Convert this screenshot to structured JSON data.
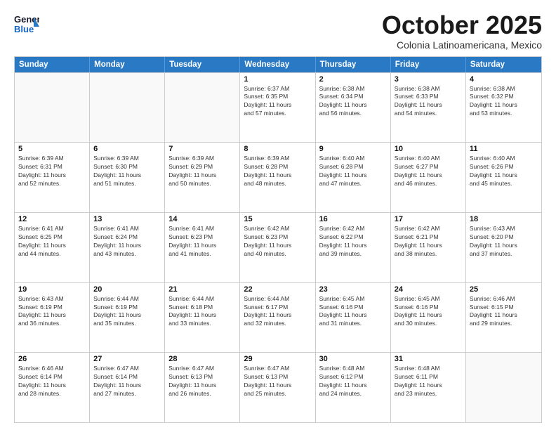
{
  "header": {
    "logo_general": "General",
    "logo_blue": "Blue",
    "title": "October 2025",
    "subtitle": "Colonia Latinoamericana, Mexico"
  },
  "weekdays": [
    "Sunday",
    "Monday",
    "Tuesday",
    "Wednesday",
    "Thursday",
    "Friday",
    "Saturday"
  ],
  "rows": [
    [
      {
        "day": "",
        "info": ""
      },
      {
        "day": "",
        "info": ""
      },
      {
        "day": "",
        "info": ""
      },
      {
        "day": "1",
        "info": "Sunrise: 6:37 AM\nSunset: 6:35 PM\nDaylight: 11 hours\nand 57 minutes."
      },
      {
        "day": "2",
        "info": "Sunrise: 6:38 AM\nSunset: 6:34 PM\nDaylight: 11 hours\nand 56 minutes."
      },
      {
        "day": "3",
        "info": "Sunrise: 6:38 AM\nSunset: 6:33 PM\nDaylight: 11 hours\nand 54 minutes."
      },
      {
        "day": "4",
        "info": "Sunrise: 6:38 AM\nSunset: 6:32 PM\nDaylight: 11 hours\nand 53 minutes."
      }
    ],
    [
      {
        "day": "5",
        "info": "Sunrise: 6:39 AM\nSunset: 6:31 PM\nDaylight: 11 hours\nand 52 minutes."
      },
      {
        "day": "6",
        "info": "Sunrise: 6:39 AM\nSunset: 6:30 PM\nDaylight: 11 hours\nand 51 minutes."
      },
      {
        "day": "7",
        "info": "Sunrise: 6:39 AM\nSunset: 6:29 PM\nDaylight: 11 hours\nand 50 minutes."
      },
      {
        "day": "8",
        "info": "Sunrise: 6:39 AM\nSunset: 6:28 PM\nDaylight: 11 hours\nand 48 minutes."
      },
      {
        "day": "9",
        "info": "Sunrise: 6:40 AM\nSunset: 6:28 PM\nDaylight: 11 hours\nand 47 minutes."
      },
      {
        "day": "10",
        "info": "Sunrise: 6:40 AM\nSunset: 6:27 PM\nDaylight: 11 hours\nand 46 minutes."
      },
      {
        "day": "11",
        "info": "Sunrise: 6:40 AM\nSunset: 6:26 PM\nDaylight: 11 hours\nand 45 minutes."
      }
    ],
    [
      {
        "day": "12",
        "info": "Sunrise: 6:41 AM\nSunset: 6:25 PM\nDaylight: 11 hours\nand 44 minutes."
      },
      {
        "day": "13",
        "info": "Sunrise: 6:41 AM\nSunset: 6:24 PM\nDaylight: 11 hours\nand 43 minutes."
      },
      {
        "day": "14",
        "info": "Sunrise: 6:41 AM\nSunset: 6:23 PM\nDaylight: 11 hours\nand 41 minutes."
      },
      {
        "day": "15",
        "info": "Sunrise: 6:42 AM\nSunset: 6:23 PM\nDaylight: 11 hours\nand 40 minutes."
      },
      {
        "day": "16",
        "info": "Sunrise: 6:42 AM\nSunset: 6:22 PM\nDaylight: 11 hours\nand 39 minutes."
      },
      {
        "day": "17",
        "info": "Sunrise: 6:42 AM\nSunset: 6:21 PM\nDaylight: 11 hours\nand 38 minutes."
      },
      {
        "day": "18",
        "info": "Sunrise: 6:43 AM\nSunset: 6:20 PM\nDaylight: 11 hours\nand 37 minutes."
      }
    ],
    [
      {
        "day": "19",
        "info": "Sunrise: 6:43 AM\nSunset: 6:19 PM\nDaylight: 11 hours\nand 36 minutes."
      },
      {
        "day": "20",
        "info": "Sunrise: 6:44 AM\nSunset: 6:19 PM\nDaylight: 11 hours\nand 35 minutes."
      },
      {
        "day": "21",
        "info": "Sunrise: 6:44 AM\nSunset: 6:18 PM\nDaylight: 11 hours\nand 33 minutes."
      },
      {
        "day": "22",
        "info": "Sunrise: 6:44 AM\nSunset: 6:17 PM\nDaylight: 11 hours\nand 32 minutes."
      },
      {
        "day": "23",
        "info": "Sunrise: 6:45 AM\nSunset: 6:16 PM\nDaylight: 11 hours\nand 31 minutes."
      },
      {
        "day": "24",
        "info": "Sunrise: 6:45 AM\nSunset: 6:16 PM\nDaylight: 11 hours\nand 30 minutes."
      },
      {
        "day": "25",
        "info": "Sunrise: 6:46 AM\nSunset: 6:15 PM\nDaylight: 11 hours\nand 29 minutes."
      }
    ],
    [
      {
        "day": "26",
        "info": "Sunrise: 6:46 AM\nSunset: 6:14 PM\nDaylight: 11 hours\nand 28 minutes."
      },
      {
        "day": "27",
        "info": "Sunrise: 6:47 AM\nSunset: 6:14 PM\nDaylight: 11 hours\nand 27 minutes."
      },
      {
        "day": "28",
        "info": "Sunrise: 6:47 AM\nSunset: 6:13 PM\nDaylight: 11 hours\nand 26 minutes."
      },
      {
        "day": "29",
        "info": "Sunrise: 6:47 AM\nSunset: 6:13 PM\nDaylight: 11 hours\nand 25 minutes."
      },
      {
        "day": "30",
        "info": "Sunrise: 6:48 AM\nSunset: 6:12 PM\nDaylight: 11 hours\nand 24 minutes."
      },
      {
        "day": "31",
        "info": "Sunrise: 6:48 AM\nSunset: 6:11 PM\nDaylight: 11 hours\nand 23 minutes."
      },
      {
        "day": "",
        "info": ""
      }
    ]
  ]
}
